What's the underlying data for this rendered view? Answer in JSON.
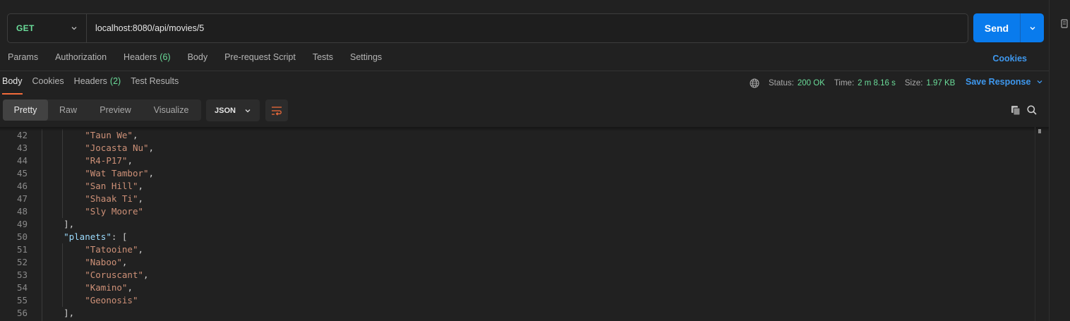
{
  "request": {
    "method": "GET",
    "url": "localhost:8080/api/movies/5",
    "send_label": "Send"
  },
  "request_tabs": [
    {
      "label": "Params",
      "count": ""
    },
    {
      "label": "Authorization",
      "count": ""
    },
    {
      "label": "Headers",
      "count": "(6)"
    },
    {
      "label": "Body",
      "count": ""
    },
    {
      "label": "Pre-request Script",
      "count": ""
    },
    {
      "label": "Tests",
      "count": ""
    },
    {
      "label": "Settings",
      "count": ""
    }
  ],
  "cookies_link": "Cookies",
  "response_tabs": [
    {
      "label": "Body",
      "count": "",
      "active": true
    },
    {
      "label": "Cookies",
      "count": "",
      "active": false
    },
    {
      "label": "Headers",
      "count": "(2)",
      "active": false
    },
    {
      "label": "Test Results",
      "count": "",
      "active": false
    }
  ],
  "status_bar": {
    "status_label": "Status:",
    "status_value": "200 OK",
    "time_label": "Time:",
    "time_value": "2 m 8.16 s",
    "size_label": "Size:",
    "size_value": "1.97 KB",
    "save_response": "Save Response"
  },
  "view_modes": [
    "Pretty",
    "Raw",
    "Preview",
    "Visualize"
  ],
  "active_view": "Pretty",
  "format": "JSON",
  "colors": {
    "send_button": "#097bed",
    "method_get": "#6bdd9a",
    "link": "#3e98ee",
    "active_tab_underline": "#f26b3a",
    "string": "#ce9178",
    "key": "#9cdcfe"
  },
  "code_lines": [
    {
      "n": "42",
      "pre": "        ",
      "key": "",
      "str": "\"Taun We\"",
      "post": ","
    },
    {
      "n": "43",
      "pre": "        ",
      "key": "",
      "str": "\"Jocasta Nu\"",
      "post": ","
    },
    {
      "n": "44",
      "pre": "        ",
      "key": "",
      "str": "\"R4-P17\"",
      "post": ","
    },
    {
      "n": "45",
      "pre": "        ",
      "key": "",
      "str": "\"Wat Tambor\"",
      "post": ","
    },
    {
      "n": "46",
      "pre": "        ",
      "key": "",
      "str": "\"San Hill\"",
      "post": ","
    },
    {
      "n": "47",
      "pre": "        ",
      "key": "",
      "str": "\"Shaak Ti\"",
      "post": ","
    },
    {
      "n": "48",
      "pre": "        ",
      "key": "",
      "str": "\"Sly Moore\"",
      "post": ""
    },
    {
      "n": "49",
      "pre": "    ",
      "key": "",
      "str": "",
      "post": "],"
    },
    {
      "n": "50",
      "pre": "    ",
      "key": "\"planets\"",
      "str": "",
      "post": ": ["
    },
    {
      "n": "51",
      "pre": "        ",
      "key": "",
      "str": "\"Tatooine\"",
      "post": ","
    },
    {
      "n": "52",
      "pre": "        ",
      "key": "",
      "str": "\"Naboo\"",
      "post": ","
    },
    {
      "n": "53",
      "pre": "        ",
      "key": "",
      "str": "\"Coruscant\"",
      "post": ","
    },
    {
      "n": "54",
      "pre": "        ",
      "key": "",
      "str": "\"Kamino\"",
      "post": ","
    },
    {
      "n": "55",
      "pre": "        ",
      "key": "",
      "str": "\"Geonosis\"",
      "post": ""
    },
    {
      "n": "56",
      "pre": "    ",
      "key": "",
      "str": "",
      "post": "],"
    }
  ]
}
